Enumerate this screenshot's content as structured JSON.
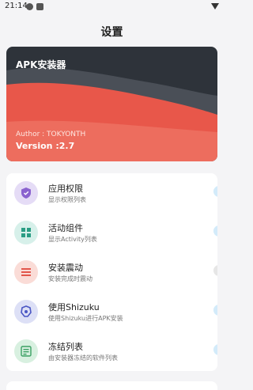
{
  "status_bar": {
    "time": "21:14"
  },
  "header": {
    "title": "设置"
  },
  "banner": {
    "app_name": "APK安装器",
    "author": "Author : TOKYONTH",
    "version": "Version :2.7",
    "colors": {
      "dark": "#2e333a",
      "accent": "#e8574a"
    }
  },
  "settings": [
    {
      "title": "应用权限",
      "subtitle": "显示权限列表",
      "icon": "shield-icon",
      "icon_bg": "#e5dcf6",
      "icon_color": "#8a62cf",
      "toggle": "on"
    },
    {
      "title": "活动组件",
      "subtitle": "显示Activity列表",
      "icon": "grid-icon",
      "icon_bg": "#d7f0ea",
      "icon_color": "#2a9d84",
      "toggle": "on"
    },
    {
      "title": "安装震动",
      "subtitle": "安装完成时震动",
      "icon": "vibrate-icon",
      "icon_bg": "#fadcd7",
      "icon_color": "#e2564b",
      "toggle": "off"
    },
    {
      "title": "使用Shizuku",
      "subtitle": "使用Shizuku进行APK安装",
      "icon": "shizuku-icon",
      "icon_bg": "#dde0f6",
      "icon_color": "#4a56c4",
      "toggle": "on"
    },
    {
      "title": "冻结列表",
      "subtitle": "由安装器冻结的软件列表",
      "icon": "list-icon",
      "icon_bg": "#d8f0e0",
      "icon_color": "#3aa063",
      "toggle": "on"
    }
  ]
}
